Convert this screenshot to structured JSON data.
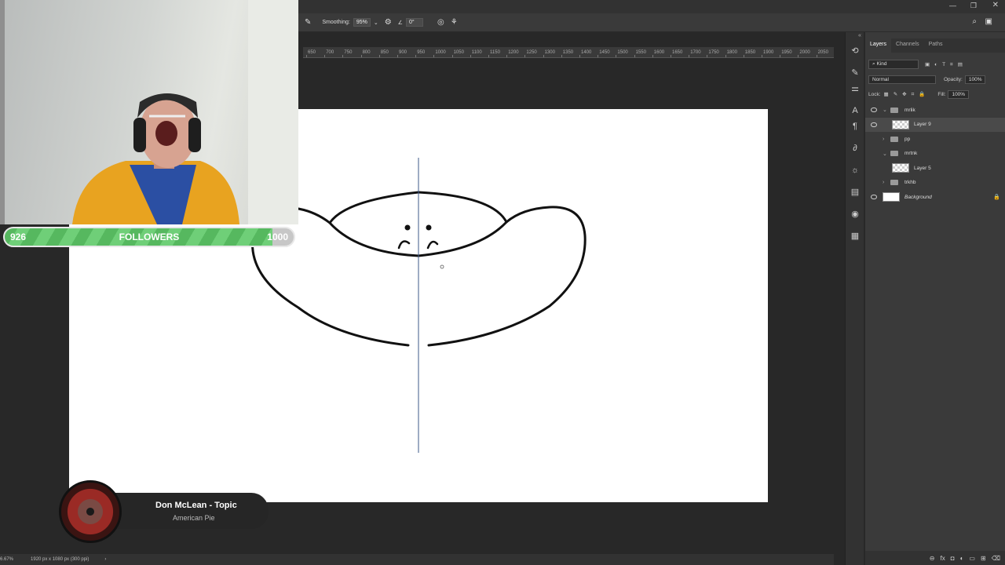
{
  "options_bar": {
    "smoothing_label": "Smoothing:",
    "smoothing_value": "95%",
    "angle_value": "0°"
  },
  "ruler": {
    "ticks": [
      "650",
      "700",
      "750",
      "800",
      "850",
      "900",
      "950",
      "1000",
      "1050",
      "1100",
      "1150",
      "1200",
      "1250",
      "1300",
      "1350",
      "1400",
      "1450",
      "1500",
      "1550",
      "1600",
      "1650",
      "1700",
      "1750",
      "1800",
      "1850",
      "1900",
      "1950",
      "2000",
      "2050"
    ]
  },
  "status": {
    "zoom": "6.67%",
    "doc_info": "1920 px x 1080 px (300 ppi)"
  },
  "panel": {
    "tabs": [
      "Layers",
      "Channels",
      "Paths"
    ],
    "filter_kind": "Kind",
    "blend_mode": "Normal",
    "opacity_label": "Opacity:",
    "opacity_value": "100%",
    "lock_label": "Lock:",
    "fill_label": "Fill:",
    "fill_value": "100%",
    "layers": [
      {
        "name": "mrlik",
        "kind": "group",
        "visible": true,
        "expanded": true,
        "selected": false
      },
      {
        "name": "Layer 9",
        "kind": "layer",
        "visible": true,
        "selected": true
      },
      {
        "name": "pp",
        "kind": "group",
        "visible": false,
        "expanded": false,
        "selected": false
      },
      {
        "name": "mrtnk",
        "kind": "group",
        "visible": false,
        "expanded": true,
        "selected": false
      },
      {
        "name": "Layer 5",
        "kind": "layer",
        "visible": false,
        "selected": false
      },
      {
        "name": "trkhb",
        "kind": "group",
        "visible": false,
        "expanded": false,
        "selected": false
      },
      {
        "name": "Background",
        "kind": "background",
        "visible": true,
        "selected": false,
        "locked": true
      }
    ]
  },
  "overlay": {
    "follower_current": "926",
    "follower_label": "FOLLOWERS",
    "follower_goal": "1000",
    "follower_progress": 0.926,
    "music_artist": "Don McLean - Topic",
    "music_track": "American Pie"
  },
  "colors": {
    "guide": "#3d5a8a",
    "follow_green": "#56b85f",
    "canvas": "#ffffff"
  }
}
